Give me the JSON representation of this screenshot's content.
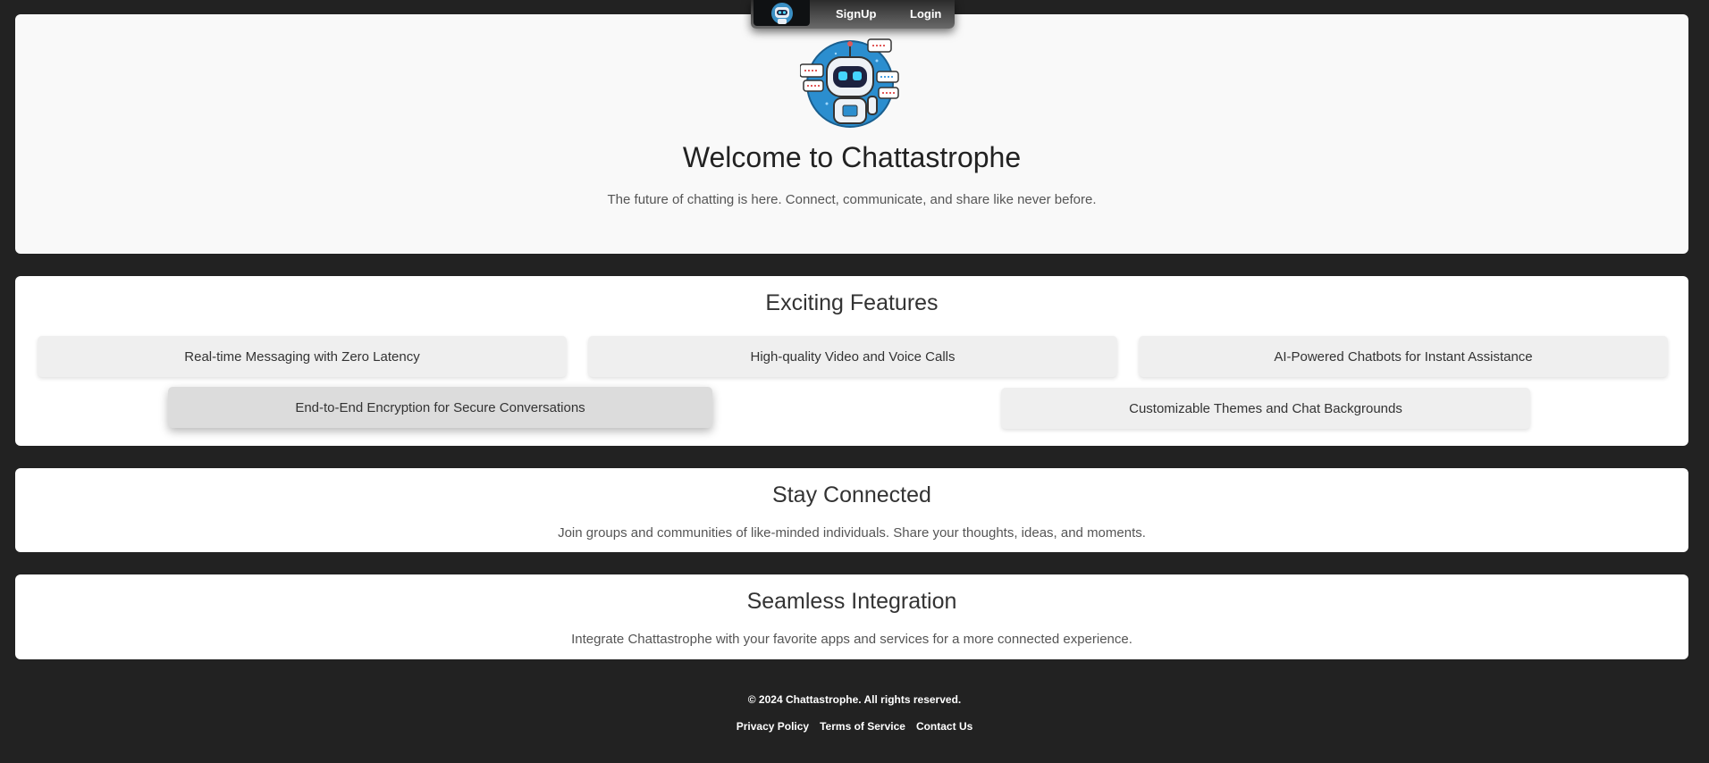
{
  "nav": {
    "logo_icon": "robot-logo-icon",
    "signup_label": "SignUp",
    "login_label": "Login"
  },
  "hero": {
    "logo_icon": "robot-mascot-icon",
    "title": "Welcome to Chattastrophe",
    "subtitle": "The future of chatting is here. Connect, communicate, and share like never before."
  },
  "features": {
    "title": "Exciting Features",
    "items": [
      "Real-time Messaging with Zero Latency",
      "High-quality Video and Voice Calls",
      "AI-Powered Chatbots for Instant Assistance",
      "End-to-End Encryption for Secure Conversations",
      "Customizable Themes and Chat Backgrounds"
    ]
  },
  "connected": {
    "title": "Stay Connected",
    "text": "Join groups and communities of like-minded individuals. Share your thoughts, ideas, and moments."
  },
  "integration": {
    "title": "Seamless Integration",
    "text": "Integrate Chattastrophe with your favorite apps and services for a more connected experience."
  },
  "footer": {
    "copyright": "© 2024 Chattastrophe. All rights reserved.",
    "links": [
      "Privacy Policy",
      "Terms of Service",
      "Contact Us"
    ]
  },
  "colors": {
    "page_background": "#222222",
    "card_background": "#ffffff",
    "hero_background": "#f9f9f9",
    "feature_background": "#efefef",
    "accent_blue": "#1f8fcf"
  }
}
